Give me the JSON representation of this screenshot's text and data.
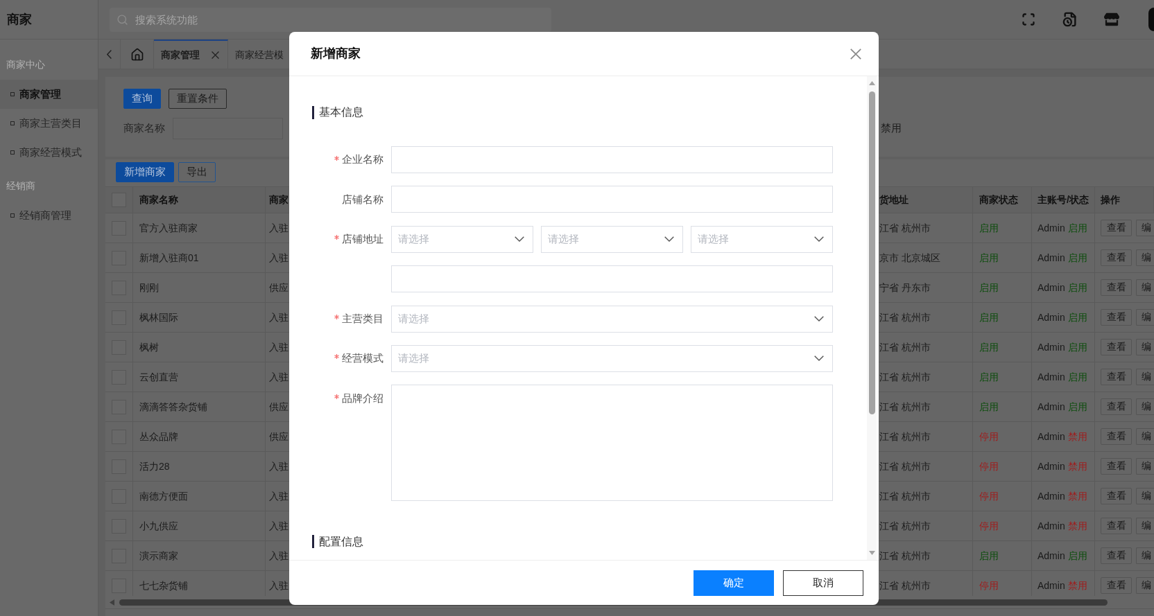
{
  "sidebar": {
    "title": "商家",
    "groups": [
      {
        "label": "商家中心",
        "items": [
          {
            "label": "商家管理",
            "selected": true
          },
          {
            "label": "商家主营类目",
            "selected": false
          },
          {
            "label": "商家经营模式",
            "selected": false
          }
        ]
      },
      {
        "label": "经销商",
        "items": [
          {
            "label": "经销商管理",
            "selected": false
          }
        ]
      }
    ]
  },
  "header": {
    "search": {
      "placeholder": "搜索系统功能"
    }
  },
  "tabs": [
    {
      "kind": "home",
      "selected": false
    },
    {
      "kind": "page",
      "label": "商家管理",
      "selected": true,
      "closable": true
    },
    {
      "kind": "page",
      "label": "商家经营模",
      "selected": false
    }
  ],
  "filter": {
    "buttons": [
      {
        "label": "查询",
        "kind": "primary"
      },
      {
        "label": "重置条件",
        "kind": "default"
      }
    ],
    "fields": [
      {
        "label": "商家名称"
      }
    ],
    "status_option": "禁用"
  },
  "toolbar": {
    "buttons": [
      {
        "label": "新增商家",
        "kind": "primary"
      },
      {
        "label": "导出",
        "kind": "outline"
      }
    ]
  },
  "table": {
    "select_all": {
      "checked": false
    },
    "columns": [
      "商家名称",
      "商家",
      "货地址",
      "商家状态",
      "主账号/状态",
      "操作"
    ],
    "rows": [
      {
        "checked": false,
        "name": "官方入驻商家",
        "column_3": "入驻",
        "column_4": "江省 杭州市",
        "status": {
          "text": "启用",
          "enabled": true
        },
        "account": "Admin",
        "account_status": {
          "text": "启用",
          "enabled": true
        },
        "actions": [
          "查看",
          "编"
        ]
      },
      {
        "checked": false,
        "name": "新增入驻商01",
        "column_3": "入驻",
        "column_4": "京市 北京城区",
        "status": {
          "text": "启用",
          "enabled": true
        },
        "account": "Admin",
        "account_status": {
          "text": "启用",
          "enabled": true
        },
        "actions": [
          "查看",
          "编"
        ]
      },
      {
        "checked": false,
        "name": "刚刚",
        "column_3": "供应",
        "column_4": "宁省 丹东市",
        "status": {
          "text": "启用",
          "enabled": true
        },
        "account": "Admin",
        "account_status": {
          "text": "启用",
          "enabled": true
        },
        "actions": [
          "查看",
          "编"
        ]
      },
      {
        "checked": false,
        "name": "枫林国际",
        "column_3": "入驻",
        "column_4": "江省 杭州市",
        "status": {
          "text": "启用",
          "enabled": true
        },
        "account": "Admin",
        "account_status": {
          "text": "启用",
          "enabled": true
        },
        "actions": [
          "查看",
          "编"
        ]
      },
      {
        "checked": false,
        "name": "枫树",
        "column_3": "入驻",
        "column_4": "江省 杭州市",
        "status": {
          "text": "启用",
          "enabled": true
        },
        "account": "Admin",
        "account_status": {
          "text": "启用",
          "enabled": true
        },
        "actions": [
          "查看",
          "编"
        ]
      },
      {
        "checked": false,
        "name": "云创直营",
        "column_3": "入驻",
        "column_4": "江省 杭州市",
        "status": {
          "text": "启用",
          "enabled": true
        },
        "account": "Admin",
        "account_status": {
          "text": "启用",
          "enabled": true
        },
        "actions": [
          "查看",
          "编"
        ]
      },
      {
        "checked": false,
        "name": "滴滴答答杂货铺",
        "column_3": "供应",
        "column_4": "江省 杭州市",
        "status": {
          "text": "启用",
          "enabled": true
        },
        "account": "Admin",
        "account_status": {
          "text": "启用",
          "enabled": true
        },
        "actions": [
          "查看",
          "编"
        ]
      },
      {
        "checked": false,
        "name": "丛众品牌",
        "column_3": "供应",
        "column_4": "江省 杭州市",
        "status": {
          "text": "停用",
          "enabled": false
        },
        "account": "Admin",
        "account_status": {
          "text": "禁用",
          "enabled": false
        },
        "actions": [
          "查看",
          "编"
        ]
      },
      {
        "checked": false,
        "name": "活力28",
        "column_3": "入驻",
        "column_4": "江省 杭州市",
        "status": {
          "text": "停用",
          "enabled": false
        },
        "account": "Admin",
        "account_status": {
          "text": "禁用",
          "enabled": false
        },
        "actions": [
          "查看",
          "编"
        ]
      },
      {
        "checked": false,
        "name": "南德方便面",
        "column_3": "入驻",
        "column_4": "江省 杭州市",
        "status": {
          "text": "停用",
          "enabled": false
        },
        "account": "Admin",
        "account_status": {
          "text": "禁用",
          "enabled": false
        },
        "actions": [
          "查看",
          "编"
        ]
      },
      {
        "checked": false,
        "name": "小九供应",
        "column_3": "入驻",
        "column_4": "江省 杭州市",
        "status": {
          "text": "停用",
          "enabled": false
        },
        "account": "Admin",
        "account_status": {
          "text": "禁用",
          "enabled": false
        },
        "actions": [
          "查看",
          "编"
        ]
      },
      {
        "checked": false,
        "name": "演示商家",
        "column_3": "入驻",
        "column_4": "江省 杭州市",
        "status": {
          "text": "启用",
          "enabled": true
        },
        "account": "Admin",
        "account_status": {
          "text": "启用",
          "enabled": true
        },
        "actions": [
          "查看",
          "编"
        ]
      },
      {
        "checked": false,
        "name": "七七杂货铺",
        "column_3": "入驻",
        "column_4": "江省 杭州市",
        "status": {
          "text": "停用",
          "enabled": false
        },
        "account": "Admin",
        "account_status": {
          "text": "禁用",
          "enabled": false
        },
        "actions": [
          "查看",
          "编"
        ]
      }
    ]
  },
  "modal": {
    "title": "新增商家",
    "sections": [
      {
        "title": "基本信息",
        "fields": [
          {
            "label": "企业名称",
            "required": true,
            "kind": "input"
          },
          {
            "label": "店铺名称",
            "required": false,
            "kind": "input"
          },
          {
            "label": "店铺地址",
            "required": true,
            "kind": "selects",
            "placeholders": [
              "请选择",
              "请选择",
              "请选择"
            ]
          },
          {
            "required": false,
            "kind": "input"
          },
          {
            "label": "主营类目",
            "required": true,
            "kind": "select",
            "placeholder": "请选择"
          },
          {
            "label": "经营模式",
            "required": true,
            "kind": "select",
            "placeholder": "请选择"
          },
          {
            "label": "品牌介绍",
            "required": true,
            "kind": "textarea"
          }
        ]
      },
      {
        "title": "配置信息"
      }
    ],
    "buttons": [
      {
        "label": "确定",
        "kind": "primary"
      },
      {
        "label": "取消",
        "kind": "default"
      }
    ]
  }
}
